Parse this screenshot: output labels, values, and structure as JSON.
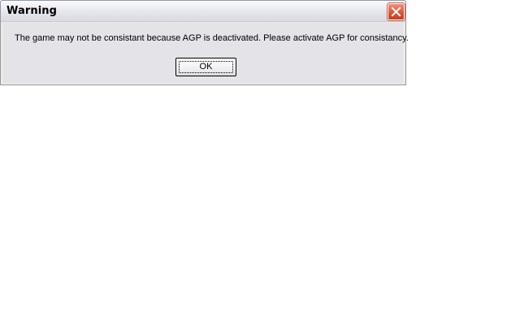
{
  "dialog": {
    "title": "Warning",
    "message": "The game may not be consistant because AGP is deactivated. Please activate AGP for consistancy.",
    "ok_label": "OK",
    "close_icon": "close-icon"
  }
}
